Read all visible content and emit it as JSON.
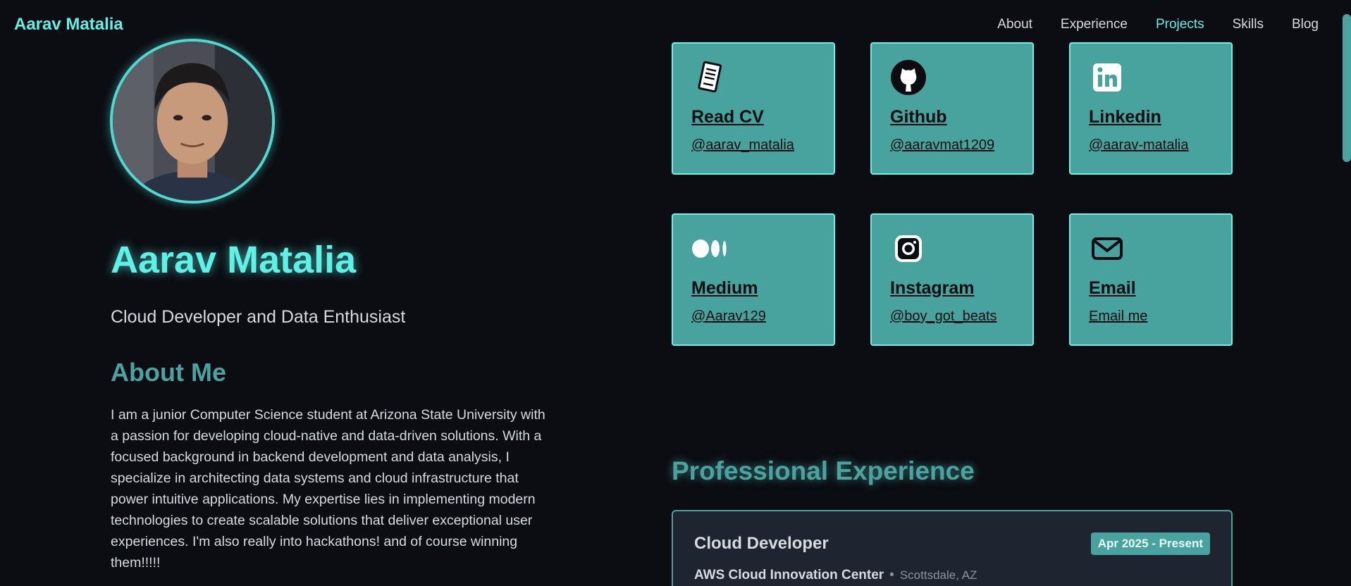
{
  "header": {
    "brand": "Aarav Matalia",
    "nav": [
      {
        "label": "About",
        "active": false
      },
      {
        "label": "Experience",
        "active": false
      },
      {
        "label": "Projects",
        "active": true
      },
      {
        "label": "Skills",
        "active": false
      },
      {
        "label": "Blog",
        "active": false
      }
    ]
  },
  "profile": {
    "avatar_alt": "profile photo",
    "name": "Aarav Matalia",
    "tagline": "Cloud Developer and Data Enthusiast"
  },
  "about": {
    "title": "About Me",
    "text": "I am a junior Computer Science student at Arizona State University with a passion for developing cloud-native and data-driven solutions. With a focused background in backend development and data analysis, I specialize in architecting data systems and cloud infrastructure that power intuitive applications. My expertise lies in implementing modern technologies to create scalable solutions that deliver exceptional user experiences. I'm also really into hackathons! and of course winning them!!!!!"
  },
  "socials": [
    {
      "icon": "document-icon",
      "title": "Read CV",
      "handle": "@aarav_matalia"
    },
    {
      "icon": "github-icon",
      "title": "Github",
      "handle": "@aaravmat1209"
    },
    {
      "icon": "linkedin-icon",
      "title": "Linkedin",
      "handle": "@aarav-matalia"
    },
    {
      "icon": "medium-icon",
      "title": "Medium",
      "handle": "@Aarav129"
    },
    {
      "icon": "instagram-icon",
      "title": "Instagram",
      "handle": "@boy_got_beats"
    },
    {
      "icon": "mail-icon",
      "title": "Email",
      "handle": "Email me"
    }
  ],
  "experience": {
    "title": "Professional Experience",
    "items": [
      {
        "role": "Cloud Developer",
        "date": "Apr 2025 - Present",
        "org": "AWS Cloud Innovation Center",
        "location": "Scottsdale, AZ"
      }
    ]
  },
  "colors": {
    "accent": "#5ff0e6",
    "card": "#48a29e",
    "background": "#0b0d12"
  }
}
